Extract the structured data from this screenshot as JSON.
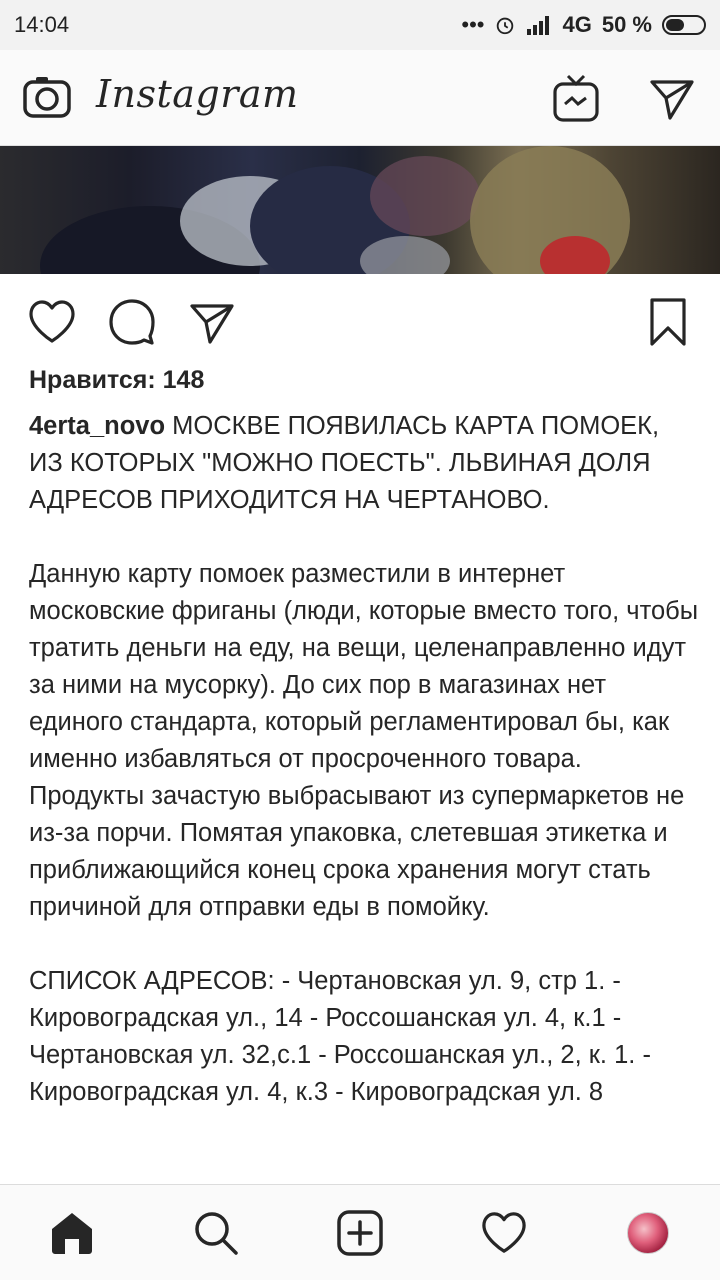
{
  "status_bar": {
    "time": "14:04",
    "network": "4G",
    "battery": "50 %",
    "battery_level": 0.5
  },
  "header": {
    "app_name": "Instagram",
    "icons": [
      "camera-icon",
      "igtv-icon",
      "direct-message-icon"
    ]
  },
  "post": {
    "actions": [
      "like-icon",
      "comment-icon",
      "share-icon",
      "bookmark-icon"
    ],
    "likes": "Нравится: 148",
    "username": "4erta_novo",
    "caption_text": " МОСКВЕ ПОЯВИЛАСЬ КАРТА ПОМОЕК, ИЗ КОТОРЫХ \"МОЖНО ПОЕСТЬ\". ЛЬВИНАЯ ДОЛЯ АДРЕСОВ ПРИХОДИТСЯ НА ЧЕРТАНОВО.\n\nДанную карту помоек разместили в интернет московские фриганы (люди, которые вместо того, чтобы тратить деньги на еду, на вещи, целенаправленно идут за ними на мусорку). До сих пор в магазинах нет единого стандарта, который регламентировал бы, как именно избавляться от просроченного товара. Продукты зачастую выбрасывают из супермаркетов не из-за порчи. Помятая упаковка, слетевшая этикетка и приближающийся конец срока хранения могут стать причиной для отправки еды в помойку.\n\nСПИСОК АДРЕСОВ: - Чертановская ул. 9, стр 1. - Кировоградская ул., 14 - Россошанская ул. 4, к.1 - Чертановская ул. 32,с.1 - Россошанская ул., 2, к. 1. - Кировоградская ул. 4, к.3 - Кировоградская ул. 8"
  },
  "bottom_nav": {
    "items": [
      "home-icon",
      "search-icon",
      "add-post-icon",
      "activity-heart-icon",
      "profile-avatar"
    ]
  }
}
